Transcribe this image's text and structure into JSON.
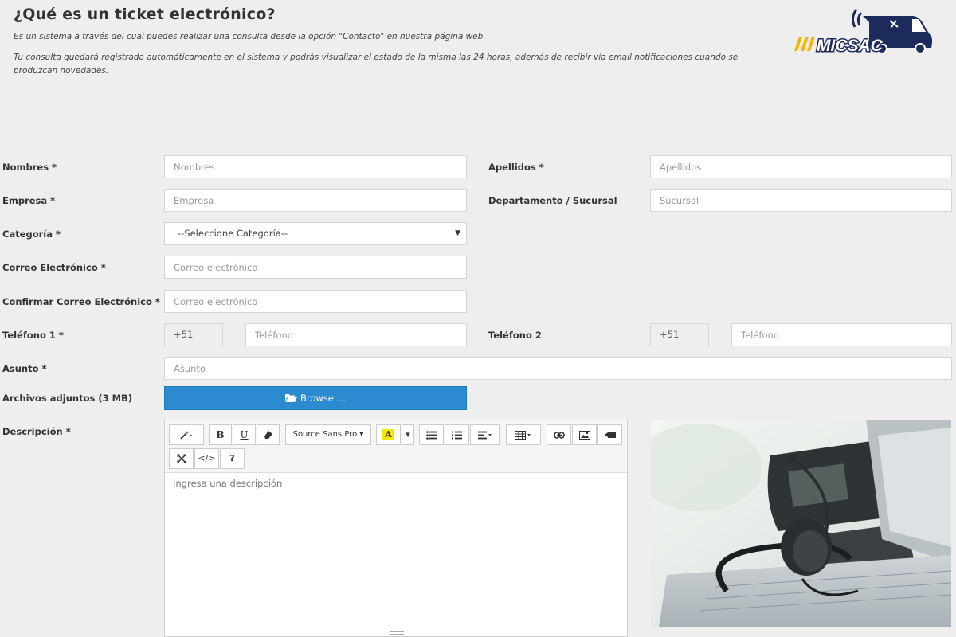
{
  "header": {
    "title": "¿Qué es un ticket electrónico?",
    "intro_1": "Es un sistema a través del cual puedes realizar una consulta desde la opción \"Contacto\" en nuestra página web.",
    "intro_2": "Tu consulta quedará registrada automáticamente en el sistema y podrás visualizar el estado de la misma las 24 horas, además de recibir vía email notificaciones cuando se produzcan novedades.",
    "logo_text": "MICSAC"
  },
  "form": {
    "nombres": {
      "label": "Nombres *",
      "placeholder": "Nombres"
    },
    "apellidos": {
      "label": "Apellidos *",
      "placeholder": "Apellidos"
    },
    "empresa": {
      "label": "Empresa *",
      "placeholder": "Empresa"
    },
    "sucursal": {
      "label": "Departamento / Sucursal",
      "placeholder": "Sucursal"
    },
    "categoria": {
      "label": "Categoría *",
      "selected": "--Seleccione Categoría--"
    },
    "correo": {
      "label": "Correo Electrónico *",
      "placeholder": "Correo electrónico"
    },
    "confirmar_correo": {
      "label": "Confirmar Correo Electrónico *",
      "placeholder": "Correo electrónico"
    },
    "telefono1": {
      "label": "Teléfono 1 *",
      "prefix": "+51",
      "placeholder": "Teléfono"
    },
    "telefono2": {
      "label": "Teléfono 2",
      "prefix": "+51",
      "placeholder": "Teléfono"
    },
    "asunto": {
      "label": "Asunto *",
      "placeholder": "Asunto"
    },
    "adjuntos": {
      "label": "Archivos adjuntos (3 MB)",
      "button": "Browse …"
    },
    "descripcion": {
      "label": "Descripción *",
      "placeholder": "Ingresa una descripción"
    }
  },
  "editor": {
    "font_name": "Source Sans Pro",
    "bold": "B",
    "underline": "U",
    "code_view": "</>",
    "help": "?",
    "color_letter": "A"
  },
  "colors": {
    "accent": "#2b8ad0",
    "logo_navy": "#1d2a5c",
    "logo_yellow": "#f4b400"
  }
}
